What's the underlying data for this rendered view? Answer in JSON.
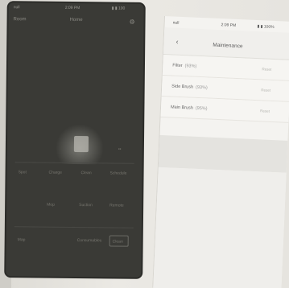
{
  "left_phone": {
    "status": {
      "carrier": "null",
      "time": "2:09 PM",
      "indicators": "▮ ▮ 100"
    },
    "header": {
      "left": "Room",
      "title": "Home",
      "right_icon": "settings-icon"
    },
    "controls_row": [
      "Spot",
      "Charge",
      "Clean",
      "Schedule"
    ],
    "controls_row2": [
      "Mop",
      "Suction",
      "Remote"
    ],
    "bottom_row": [
      "Map",
      "Consumables"
    ],
    "bottom_button": "Clean"
  },
  "right_phone": {
    "status": {
      "carrier": "null",
      "time": "2:09 PM",
      "indicators": "▮ ▮ 100%"
    },
    "back_icon": "chevron-left-icon",
    "title": "Maintenance",
    "items": [
      {
        "name": "Filter",
        "percent": "(93%)",
        "action": "Reset"
      },
      {
        "name": "Side Brush",
        "percent": "(93%)",
        "action": "Reset"
      },
      {
        "name": "Main Brush",
        "percent": "(95%)",
        "action": "Reset"
      }
    ]
  },
  "colors": {
    "dark_screen": "#3a3a36",
    "light_screen": "#f4f3f0",
    "background": "#e6e4df"
  }
}
